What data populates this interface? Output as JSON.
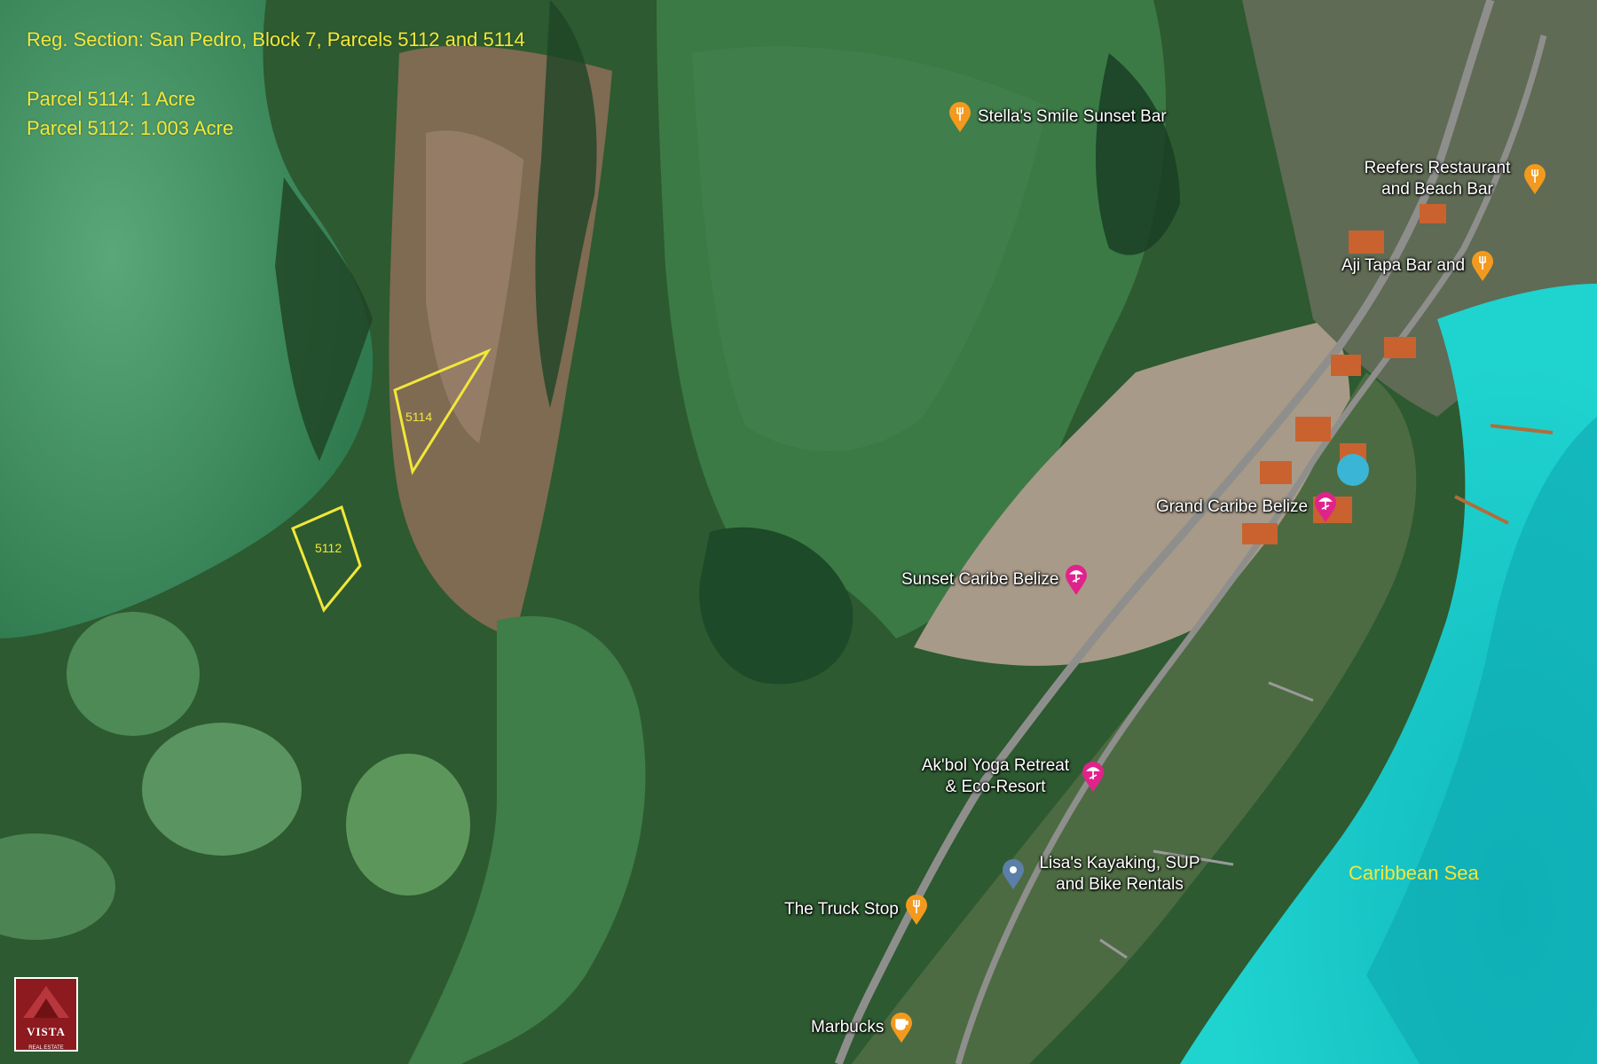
{
  "info": {
    "title": "Reg. Section:  San Pedro, Block 7, Parcels 5112 and 5114",
    "parcel_5114": "Parcel 5114: 1 Acre",
    "parcel_5112": "Parcel 5112: 1.003 Acre"
  },
  "parcels": [
    {
      "id": "5114"
    },
    {
      "id": "5112"
    }
  ],
  "pois": [
    {
      "label": "Stella's Smile Sunset Bar",
      "icon": "restaurant-pin-icon"
    },
    {
      "label": "Reefers Restaurant and Beach Bar",
      "icon": "restaurant-pin-icon"
    },
    {
      "label": "Aji Tapa Bar and",
      "icon": "restaurant-pin-icon"
    },
    {
      "label": "Grand Caribe Belize",
      "icon": "hotel-pin-icon"
    },
    {
      "label": "Sunset Caribe Belize",
      "icon": "hotel-pin-icon"
    },
    {
      "label": "Ak'bol Yoga Retreat & Eco-Resort",
      "icon": "hotel-pin-icon"
    },
    {
      "label": "Lisa's Kayaking, SUP and Bike Rentals",
      "icon": "location-pin-icon"
    },
    {
      "label": "The Truck Stop",
      "icon": "restaurant-pin-icon"
    },
    {
      "label": "Marbucks",
      "icon": "cafe-pin-icon"
    }
  ],
  "sea_label": "Caribbean Sea",
  "logo": {
    "name": "VISTA",
    "sub": "REAL ESTATE"
  },
  "colors": {
    "annotation": "#f2e73a",
    "restaurant_pin": "#f39a1e",
    "hotel_pin": "#e0238a",
    "location_pin": "#5b7fa8",
    "sea": "#1fc7c8",
    "lagoon": "#3f9a6a"
  }
}
